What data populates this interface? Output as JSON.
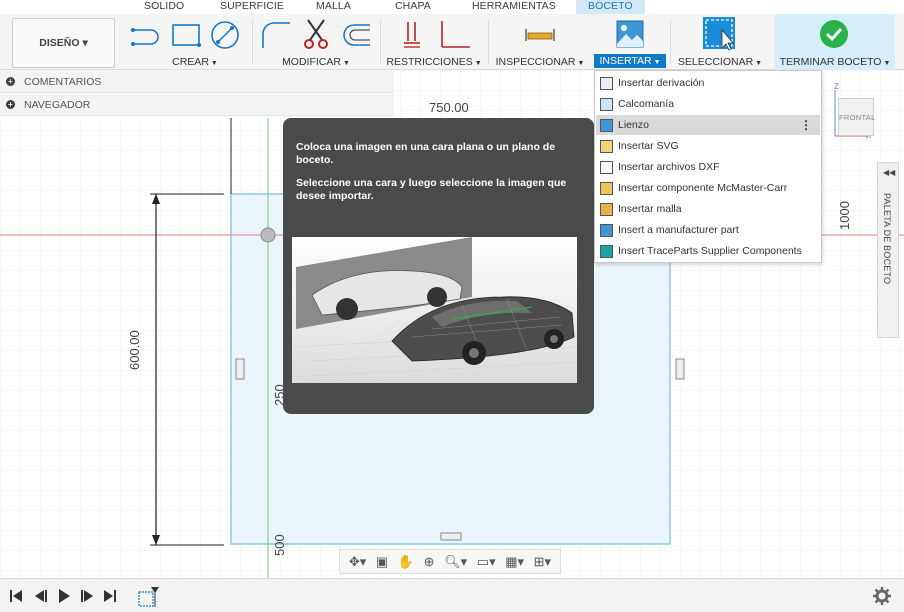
{
  "tabs": [
    "SOLIDO",
    "SUPERFICIE",
    "MALLA",
    "CHAPA",
    "HERRAMIENTAS",
    "BOCETO"
  ],
  "active_tab": "BOCETO",
  "design_button": "DISEÑO ▾",
  "groups": {
    "crear": "CREAR",
    "modificar": "MODIFICAR",
    "restricciones": "RESTRICCIONES",
    "inspeccionar": "INSPECCIONAR",
    "insertar": "INSERTAR",
    "seleccionar": "SELECCIONAR",
    "terminar": "TERMINAR BOCETO"
  },
  "panels": {
    "comentarios": "COMENTARIOS",
    "navegador": "NAVEGADOR"
  },
  "dimensions": {
    "top": "750.00",
    "left": "600.00",
    "right": "1000",
    "inner_250": "250",
    "inner_500": "500"
  },
  "tooltip": {
    "line1": "Coloca una imagen en una cara plana o un plano de boceto.",
    "line2": "Seleccione una cara y luego seleccione la imagen que desee importar."
  },
  "insert_menu": [
    {
      "label": "Insertar derivación",
      "icon": "derive-icon"
    },
    {
      "label": "Calcomanía",
      "icon": "decal-icon"
    },
    {
      "label": "Lienzo",
      "icon": "canvas-icon",
      "highlighted": true
    },
    {
      "label": "Insertar SVG",
      "icon": "svg-icon"
    },
    {
      "label": "Insertar archivos DXF",
      "icon": "dxf-icon"
    },
    {
      "label": "Insertar componente McMaster-Carr",
      "icon": "mcmaster-icon"
    },
    {
      "label": "Insertar malla",
      "icon": "mesh-icon"
    },
    {
      "label": "Insert a manufacturer part",
      "icon": "manufacturer-icon"
    },
    {
      "label": "Insert TraceParts Supplier Components",
      "icon": "traceparts-icon"
    }
  ],
  "viewcube_label": "FRONTAL",
  "palette_label": "PALETA DE BOCETO",
  "colors": {
    "accent": "#0f7ac5",
    "sketch_box_fill": "#eaf4fb",
    "sketch_box_border": "#8ec7e8",
    "axis_red": "#e08080",
    "axis_green": "#7cc87c",
    "check_green": "#2bb24a"
  }
}
